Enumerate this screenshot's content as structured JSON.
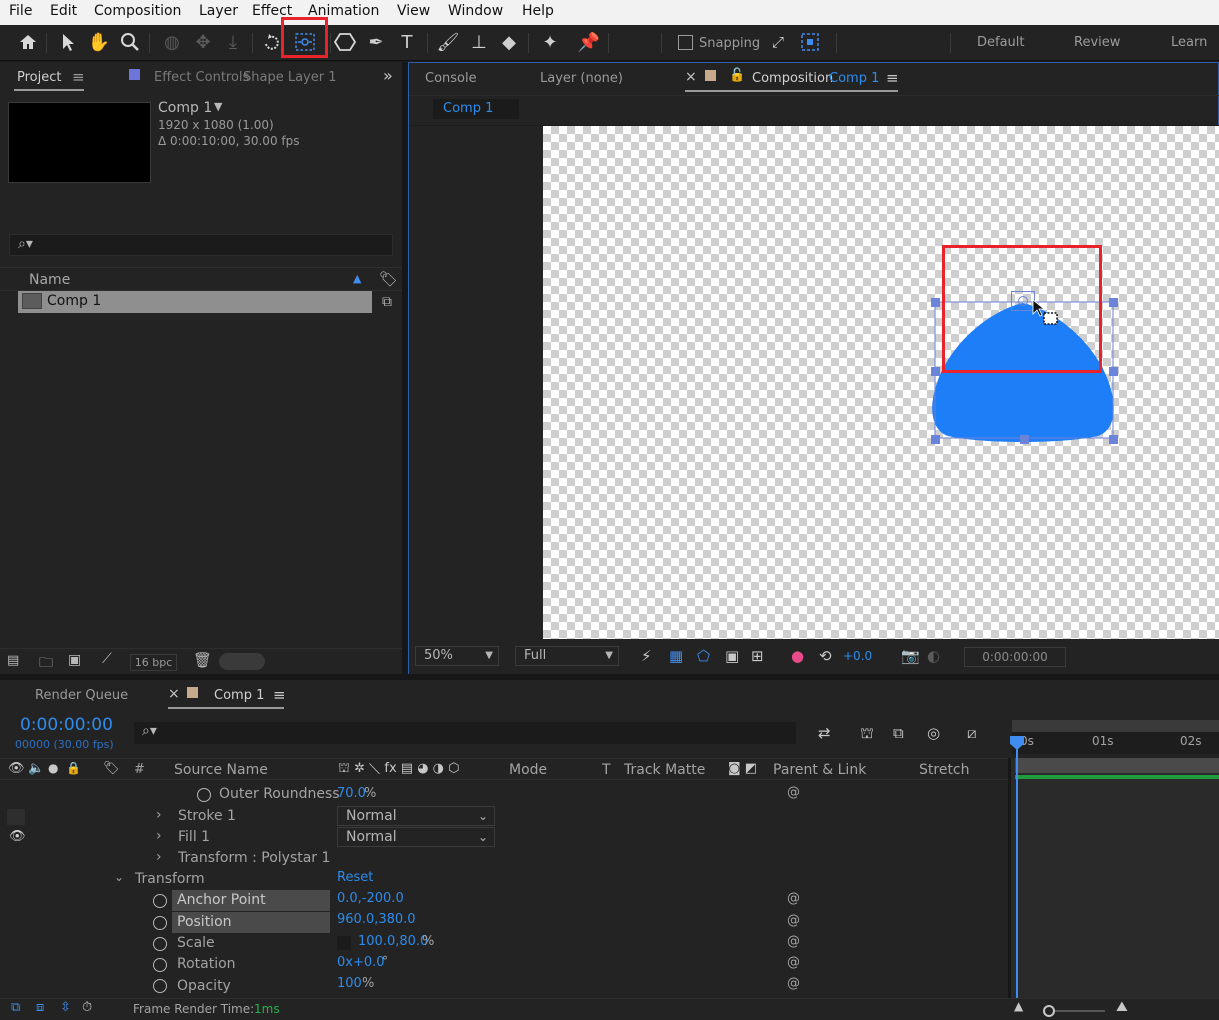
{
  "menu": [
    "File",
    "Edit",
    "Composition",
    "Layer",
    "Effect",
    "Animation",
    "View",
    "Window",
    "Help"
  ],
  "toolbar": {
    "snapping_label": "Snapping",
    "workspaces": [
      "Default",
      "Review",
      "Learn"
    ]
  },
  "project_panel": {
    "tab_project": "Project",
    "tab_effect_controls": "Effect Controls",
    "effect_controls_layer": "Shape Layer 1",
    "comp_name": "Comp 1",
    "comp_info_1": "1920 x 1080 (1.00)",
    "comp_info_2": "Δ 0:00:10:00, 30.00 fps",
    "search_placeholder": "",
    "column_name": "Name",
    "items": [
      "Comp 1"
    ],
    "bpc": "16 bpc"
  },
  "comp_panel": {
    "tab_console": "Console",
    "tab_layer": "Layer (none)",
    "tab_composition": "Composition",
    "tab_composition_name": "Comp 1",
    "breadcrumb": "Comp 1",
    "zoom": "50%",
    "resolution": "Full",
    "exposure": "+0.0",
    "timecode": "0:00:00:00"
  },
  "timeline": {
    "tab_render_queue": "Render Queue",
    "tab_comp": "Comp 1",
    "timecode": "0:00:00:00",
    "frame_info": "00000 (30.00 fps)",
    "col_hash": "#",
    "col_source_name": "Source Name",
    "col_mode": "Mode",
    "col_t": "T",
    "col_track_matte": "Track Matte",
    "col_parent": "Parent & Link",
    "col_stretch": "Stretch",
    "ruler": [
      "0s",
      "01s",
      "02s"
    ],
    "rows": {
      "outer_roundness": {
        "label": "Outer Roundness",
        "value": "70.0",
        "unit": "%"
      },
      "stroke": {
        "label": "Stroke 1",
        "mode": "Normal"
      },
      "fill": {
        "label": "Fill 1",
        "mode": "Normal"
      },
      "transform_polystar": {
        "label": "Transform : Polystar 1"
      },
      "transform": {
        "label": "Transform",
        "reset": "Reset"
      },
      "anchor": {
        "label": "Anchor Point",
        "value": "0.0,-200.0"
      },
      "position": {
        "label": "Position",
        "value": "960.0,380.0"
      },
      "scale": {
        "label": "Scale",
        "value": "100.0,80.0",
        "unit": "%"
      },
      "rotation": {
        "label": "Rotation",
        "value": "0x+0.0",
        "unit": "°"
      },
      "opacity": {
        "label": "Opacity",
        "value": "100",
        "unit": "%"
      }
    },
    "frame_render_label": "Frame Render Time:",
    "frame_render_value": "1ms"
  },
  "colors": {
    "accent": "#2d8ceb",
    "shape_fill": "#1e7ef7",
    "highlight": "#e8232c"
  }
}
